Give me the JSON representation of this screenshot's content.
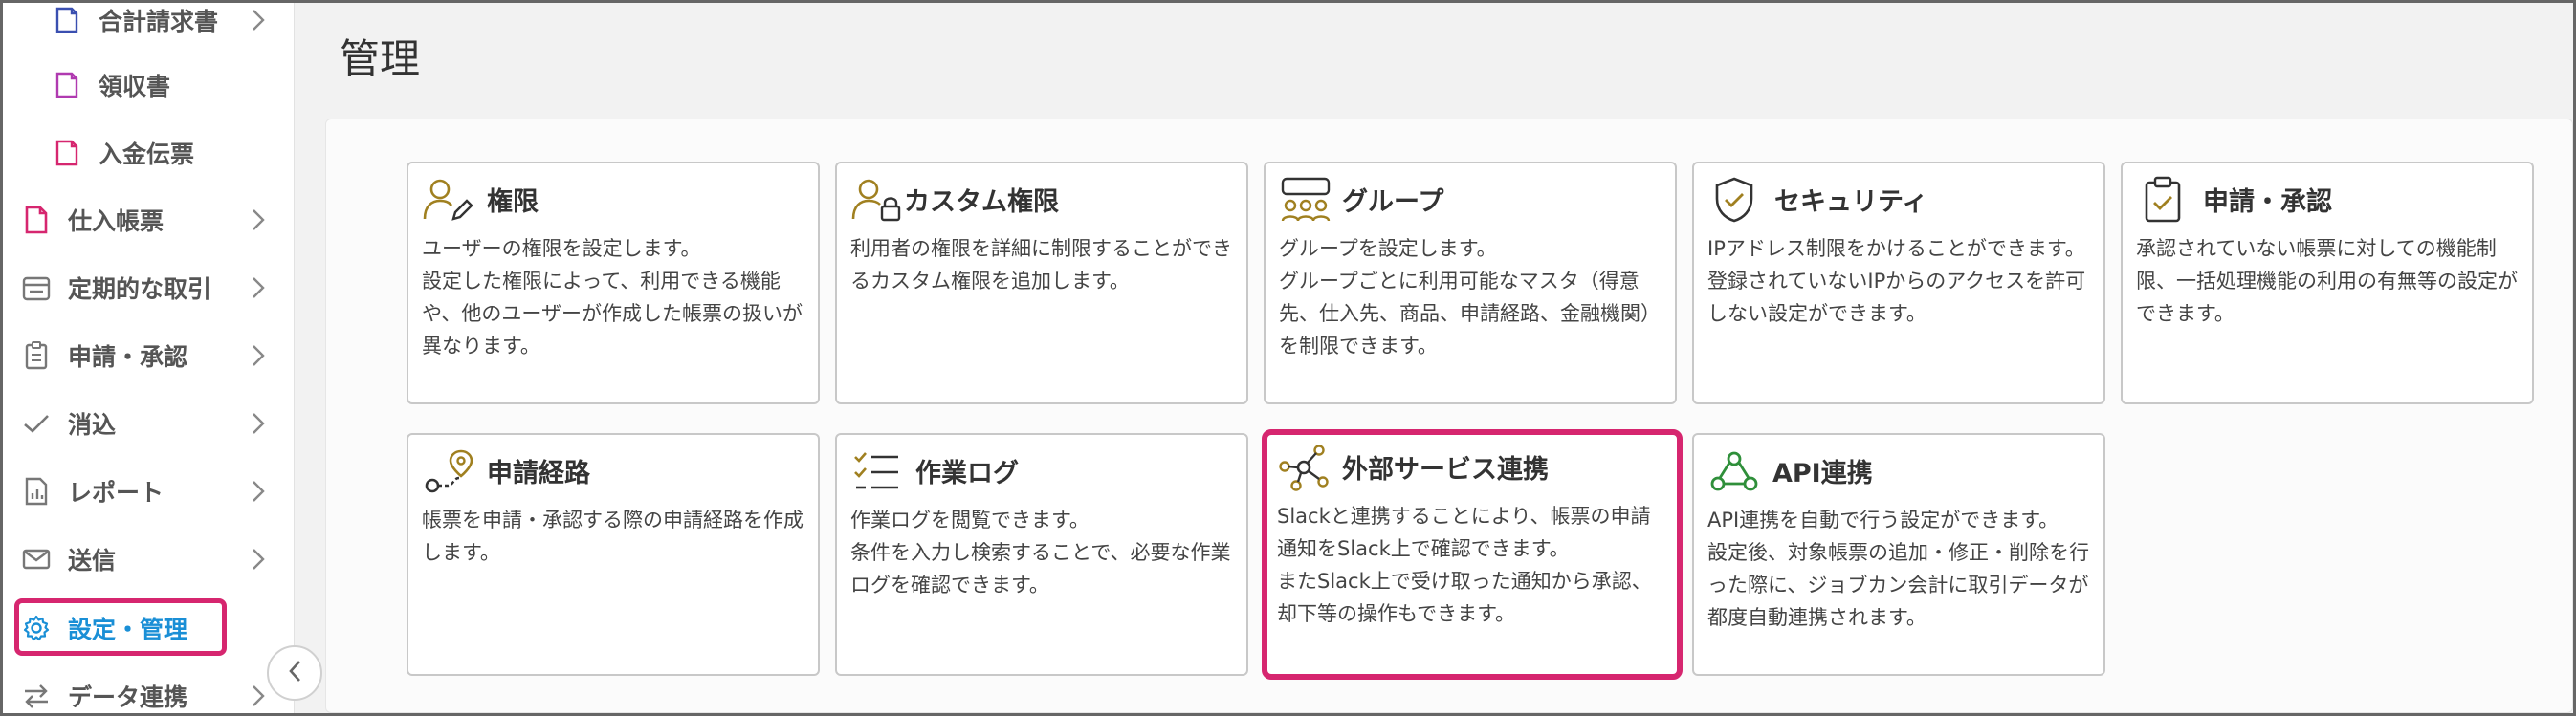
{
  "sidebar": {
    "items": [
      {
        "label": "合計請求書",
        "icon": "document-icon"
      },
      {
        "label": "領収書",
        "icon": "document-icon"
      },
      {
        "label": "入金伝票",
        "icon": "document-icon"
      },
      {
        "label": "仕入帳票",
        "icon": "file-icon"
      },
      {
        "label": "定期的な取引",
        "icon": "calendar-icon"
      },
      {
        "label": "申請・承認",
        "icon": "clipboard-icon"
      },
      {
        "label": "消込",
        "icon": "check-icon"
      },
      {
        "label": "レポート",
        "icon": "report-icon"
      },
      {
        "label": "送信",
        "icon": "mail-icon"
      },
      {
        "label": "設定・管理",
        "icon": "gear-icon"
      },
      {
        "label": "データ連携",
        "icon": "swap-icon"
      }
    ]
  },
  "main": {
    "title": "管理",
    "cards": [
      {
        "title": "権限",
        "icon": "user-edit-icon",
        "desc": "ユーザーの権限を設定します。\n設定した権限によって、利用できる機能や、他のユーザーが作成した帳票の扱いが異なります。"
      },
      {
        "title": "カスタム権限",
        "icon": "user-lock-icon",
        "desc": "利用者の権限を詳細に制限することができるカスタム権限を追加します。"
      },
      {
        "title": "グループ",
        "icon": "group-icon",
        "desc": "グループを設定します。\nグループごとに利用可能なマスタ（得意先、仕入先、商品、申請経路、金融機関）を制限できます。"
      },
      {
        "title": "セキュリティ",
        "icon": "shield-check-icon",
        "desc": "IPアドレス制限をかけることができます。\n登録されていないIPからのアクセスを許可しない設定ができます。"
      },
      {
        "title": "申請・承認",
        "icon": "clipboard-check-icon",
        "desc": "承認されていない帳票に対しての機能制限、一括処理機能の利用の有無等の設定ができます。"
      },
      {
        "title": "申請経路",
        "icon": "route-icon",
        "desc": "帳票を申請・承認する際の申請経路を作成します。"
      },
      {
        "title": "作業ログ",
        "icon": "checklist-icon",
        "desc": "作業ログを閲覧できます。\n条件を入力し検索することで、必要な作業ログを確認できます。"
      },
      {
        "title": "外部サービス連携",
        "icon": "network-icon",
        "desc": "Slackと連携することにより、帳票の申請通知をSlack上で確認できます。\nまたSlack上で受け取った通知から承認、却下等の操作もできます。"
      },
      {
        "title": "API連携",
        "icon": "webhook-icon",
        "desc": "API連携を自動で行う設定ができます。\n設定後、対象帳票の追加・修正・削除を行った際に、ジョブカン会計に取引データが都度自動連携されます。"
      }
    ]
  },
  "colors": {
    "accent": "#d6266f",
    "active_text": "#1a8fd6",
    "icon_gold": "#a08020",
    "icon_green": "#2f8f3a",
    "doc_pink": "#d6266f",
    "doc_purple": "#b03ab0",
    "doc_blue": "#3a4fb0"
  }
}
